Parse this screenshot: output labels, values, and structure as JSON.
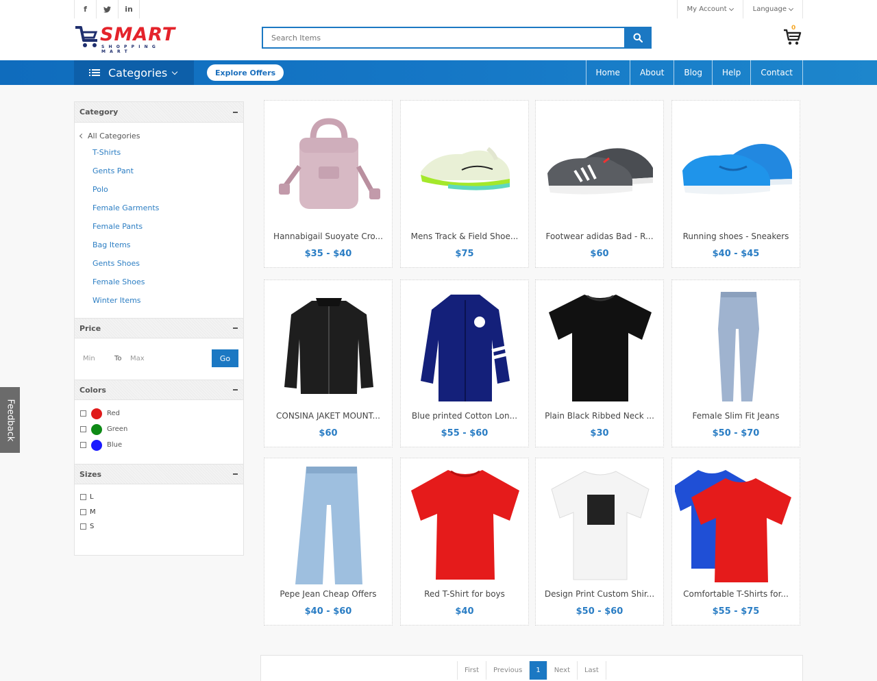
{
  "topbar": {
    "social": [
      "f",
      "t",
      "in"
    ],
    "account": "My Account",
    "language": "Language"
  },
  "header": {
    "logo_main": "SMART",
    "logo_sub": "SHOPPING MART",
    "search_placeholder": "Search Items",
    "cart_count": "0"
  },
  "nav": {
    "categories": "Categories",
    "explore": "Explore Offers",
    "menu": [
      "Home",
      "About",
      "Blog",
      "Help",
      "Contact"
    ]
  },
  "sidebar": {
    "category_title": "Category",
    "all_categories": "All Categories",
    "categories": [
      "T-Shirts",
      "Gents Pant",
      "Polo",
      "Female Garments",
      "Female Pants",
      "Bag Items",
      "Gents Shoes",
      "Female Shoes",
      "Winter Items"
    ],
    "price_title": "Price",
    "min_label": "Min",
    "to_label": "To",
    "max_label": "Max",
    "go_label": "Go",
    "colors_title": "Colors",
    "colors": [
      {
        "name": "Red",
        "hex": "#e01b1b"
      },
      {
        "name": "Green",
        "hex": "#0e8a16"
      },
      {
        "name": "Blue",
        "hex": "#1a1aff"
      }
    ],
    "sizes_title": "Sizes",
    "sizes": [
      "L",
      "M",
      "S"
    ]
  },
  "products": [
    {
      "name": "Hannabigail Suoyate Cro...",
      "price": "$35 - $40"
    },
    {
      "name": "Mens Track & Field Shoe...",
      "price": "$75"
    },
    {
      "name": "Footwear adidas Bad - R...",
      "price": "$60"
    },
    {
      "name": "Running shoes - Sneakers",
      "price": "$40 - $45"
    },
    {
      "name": "CONSINA JAKET MOUNT...",
      "price": "$60"
    },
    {
      "name": "Blue printed Cotton Lon...",
      "price": "$55 - $60"
    },
    {
      "name": "Plain Black Ribbed Neck ...",
      "price": "$30"
    },
    {
      "name": "Female Slim Fit Jeans",
      "price": "$50 - $70"
    },
    {
      "name": "Pepe Jean Cheap Offers",
      "price": "$40 - $60"
    },
    {
      "name": "Red T-Shirt for boys",
      "price": "$40"
    },
    {
      "name": "Design Print Custom Shir...",
      "price": "$50 - $60"
    },
    {
      "name": "Comfortable T-Shirts for...",
      "price": "$55 - $75"
    }
  ],
  "pagination": {
    "first": "First",
    "previous": "Previous",
    "current": "1",
    "next": "Next",
    "last": "Last"
  },
  "feedback": "Feedback"
}
